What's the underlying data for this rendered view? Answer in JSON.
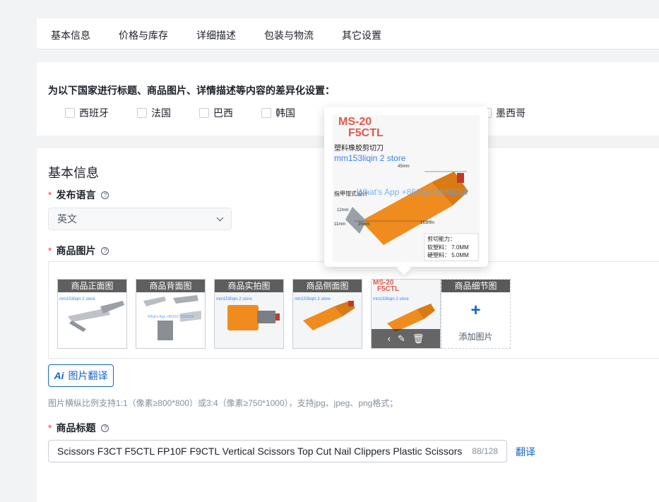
{
  "tabs": [
    {
      "label": "基本信息"
    },
    {
      "label": "价格与库存"
    },
    {
      "label": "详细描述"
    },
    {
      "label": "包装与物流"
    },
    {
      "label": "其它设置"
    }
  ],
  "country_settings": {
    "title": "为以下国家进行标题、商品图片、详情描述等内容的差异化设置：",
    "countries": [
      {
        "label": "西班牙",
        "checked": false
      },
      {
        "label": "法国",
        "checked": false
      },
      {
        "label": "巴西",
        "checked": false
      },
      {
        "label": "韩国",
        "checked": false
      },
      {
        "label": "墨西哥",
        "checked": false
      }
    ]
  },
  "basic_info": {
    "section_title": "基本信息",
    "language": {
      "label": "发布语言",
      "required_mark": "*",
      "value": "英文"
    },
    "images": {
      "label": "商品图片",
      "required_mark": "*",
      "slots": [
        {
          "caption": "商品正面图",
          "watermark": "mm153liqin 2 store"
        },
        {
          "caption": "商品背面图",
          "watermark": "What's App +8615273589266"
        },
        {
          "caption": "商品实拍图",
          "watermark": "mm153liqin 2 store"
        },
        {
          "caption": "商品侧面图",
          "watermark": "mm153liqin 2 store"
        },
        {
          "caption": "",
          "watermark": "mm153liqin 2 store",
          "title_line1": "MS-20",
          "title_line2": "F5CTL"
        }
      ],
      "add_slot": {
        "caption": "商品细节图",
        "plus": "+",
        "label": "添加图片"
      },
      "translate_button": {
        "icon": "Ai",
        "label": "图片翻译"
      },
      "hint": "图片横纵比例支持1:1（像素≥800*800）或3:4（像素≥750*1000），支持jpg、jpeg、png格式；"
    },
    "product_title": {
      "label": "商品标题",
      "required_mark": "*",
      "value": "Scissors F3CT F5CTL FP10F F9CTL Vertical Scissors Top Cut Nail Clippers Plastic Scissors",
      "count": "88/128",
      "translate_link": "翻译"
    }
  },
  "preview_popover": {
    "title_line1": "MS-20",
    "title_line2": "F5CTL",
    "subtitle": "塑料橡胶剪切刀",
    "watermark_store": "mm153liqin 2 store",
    "watermark_whatsapp": "What's App +8615273589266",
    "dim_45": "45mm",
    "dim_12": "12mm",
    "dim_11": "11mm",
    "dim_25": "25mm",
    "dim_163": "163mm",
    "label_install": "指甲钳式设计",
    "capacity_title": "剪切能力：",
    "capacity_soft": "软塑料：  7.0MM",
    "capacity_hard": "硬塑料：  5.0MM"
  },
  "colors": {
    "primary": "#1664d0",
    "required": "#f53f3f",
    "tool_orange": "#f08c1e"
  }
}
